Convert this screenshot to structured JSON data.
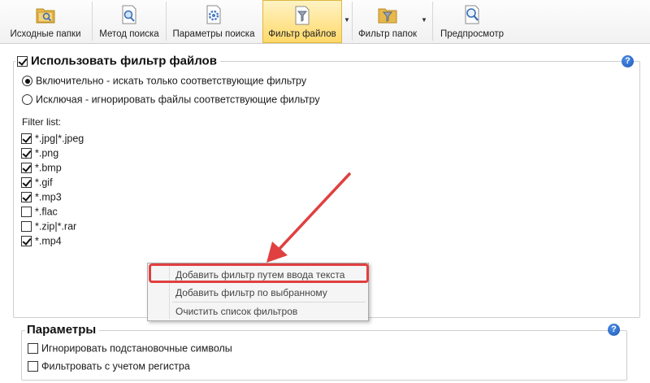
{
  "toolbar": {
    "items": [
      {
        "label": "Исходные папки",
        "icon": "source-folders-icon"
      },
      {
        "label": "Метод поиска",
        "icon": "search-method-icon"
      },
      {
        "label": "Параметры поиска",
        "icon": "search-params-icon"
      },
      {
        "label": "Фильтр файлов",
        "icon": "file-filter-icon",
        "active": true
      },
      {
        "label": "Фильтр папок",
        "icon": "folder-filter-icon"
      },
      {
        "label": "Предпросмотр",
        "icon": "preview-icon"
      }
    ]
  },
  "file_filter": {
    "title": "Использовать фильтр файлов",
    "enabled": true,
    "include_label": "Включительно - искать только соответствующие фильтру",
    "exclude_label": "Исключая - игнорировать файлы соответствующие фильтру",
    "mode": "include",
    "filter_list_label": "Filter list:",
    "filters": [
      {
        "pattern": "*.jpg|*.jpeg",
        "checked": true
      },
      {
        "pattern": "*.png",
        "checked": true
      },
      {
        "pattern": "*.bmp",
        "checked": true
      },
      {
        "pattern": "*.gif",
        "checked": true
      },
      {
        "pattern": "*.mp3",
        "checked": true
      },
      {
        "pattern": "*.flac",
        "checked": false
      },
      {
        "pattern": "*.zip|*.rar",
        "checked": false
      },
      {
        "pattern": "*.mp4",
        "checked": true
      }
    ]
  },
  "context_menu": {
    "items": [
      "Добавить фильтр путем ввода текста",
      "Добавить фильтр по выбранному",
      "Очистить список фильтров"
    ],
    "highlighted_index": 0
  },
  "parameters": {
    "title": "Параметры",
    "options": [
      {
        "label": "Игнорировать подстановочные символы",
        "checked": false
      },
      {
        "label": "Фильтровать с учетом регистра",
        "checked": false
      }
    ]
  },
  "help_symbol": "?",
  "colors": {
    "annotation": "#e04040",
    "active_tab": "#ffd96a",
    "help": "#1c59b8"
  }
}
